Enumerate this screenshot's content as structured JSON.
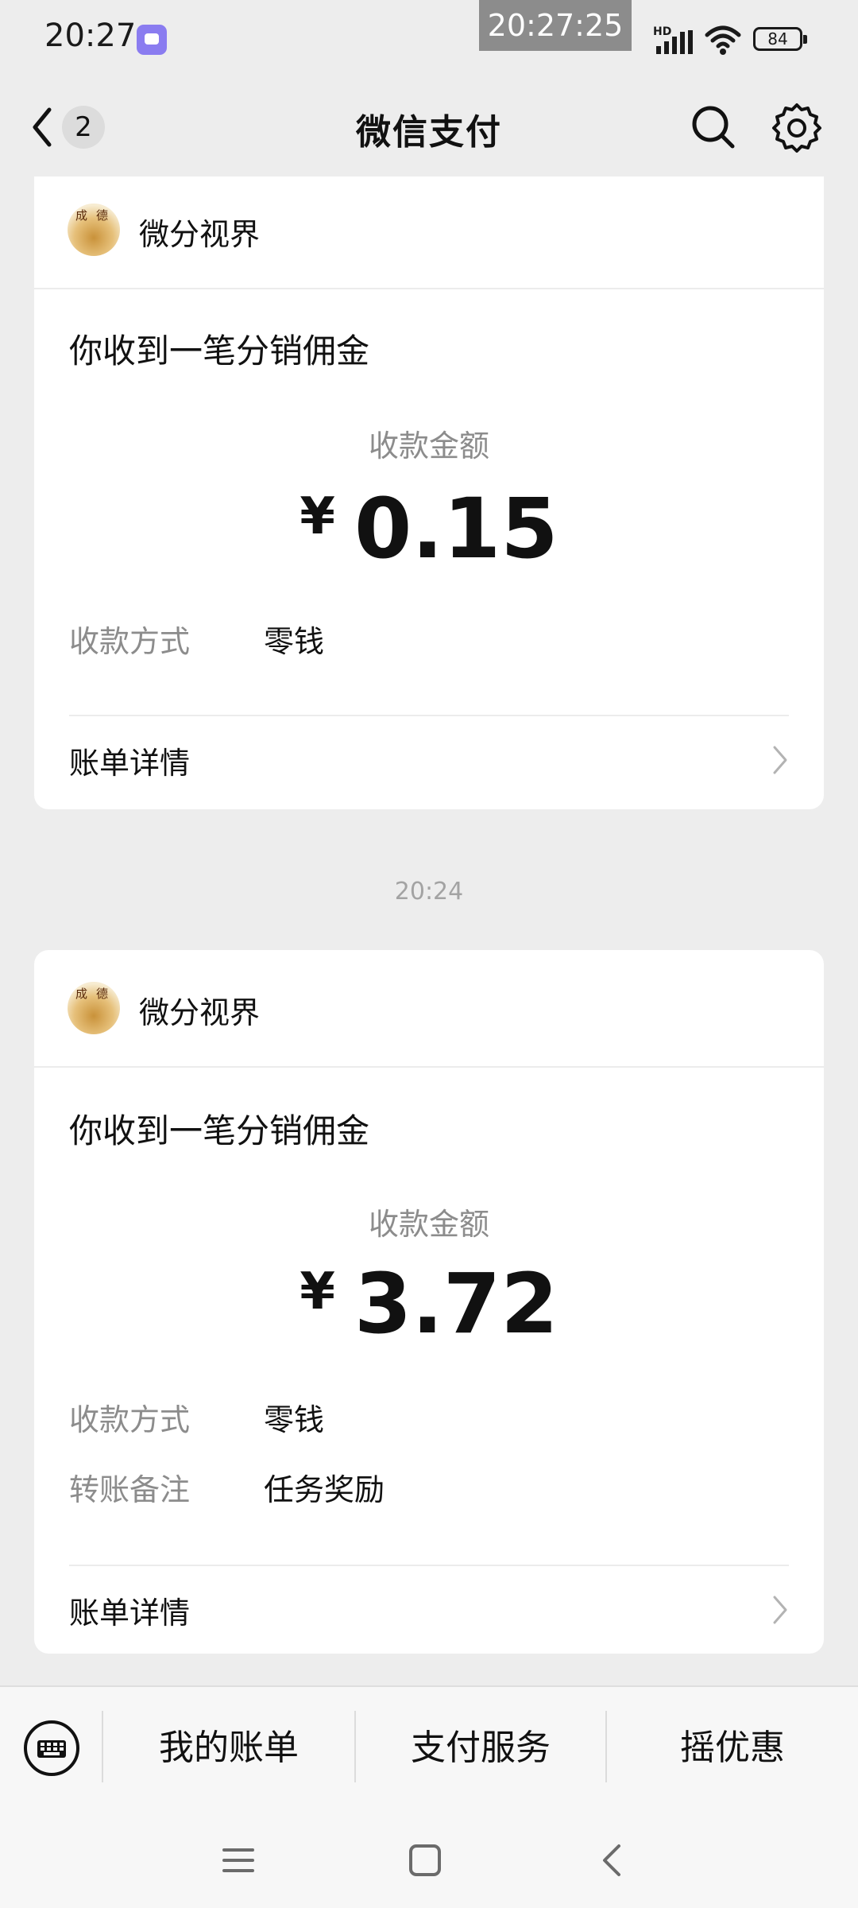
{
  "status_bar": {
    "time": "20:27",
    "clock_overlay": "20:27:25",
    "network": "HD",
    "battery": "84"
  },
  "header": {
    "unread_count": "2",
    "title": "微信支付"
  },
  "messages": [
    {
      "merchant": "微分视界",
      "avatar_text": [
        "成",
        "德"
      ],
      "title": "你收到一笔分销佣金",
      "amount_label": "收款金额",
      "currency": "¥",
      "amount": "0.15",
      "fields": [
        {
          "label": "收款方式",
          "value": "零钱"
        }
      ],
      "detail_label": "账单详情"
    },
    {
      "merchant": "微分视界",
      "avatar_text": [
        "成",
        "德"
      ],
      "title": "你收到一笔分销佣金",
      "amount_label": "收款金额",
      "currency": "¥",
      "amount": "3.72",
      "fields": [
        {
          "label": "收款方式",
          "value": "零钱"
        },
        {
          "label": "转账备注",
          "value": "任务奖励"
        }
      ],
      "detail_label": "账单详情"
    }
  ],
  "time_separator": "20:24",
  "bottom_menu": {
    "items": [
      "我的账单",
      "支付服务",
      "摇优惠"
    ]
  },
  "colors": {
    "background": "#ededed",
    "card": "#ffffff",
    "secondary_text": "#8c8c8c",
    "primary_text": "#111111"
  },
  "icons": [
    "back-chevron-icon",
    "search-icon",
    "gear-icon",
    "keyboard-icon",
    "chevron-right-icon",
    "menu-lines-icon",
    "home-square-icon",
    "nav-back-icon",
    "signal-icon",
    "wifi-icon",
    "battery-icon"
  ]
}
